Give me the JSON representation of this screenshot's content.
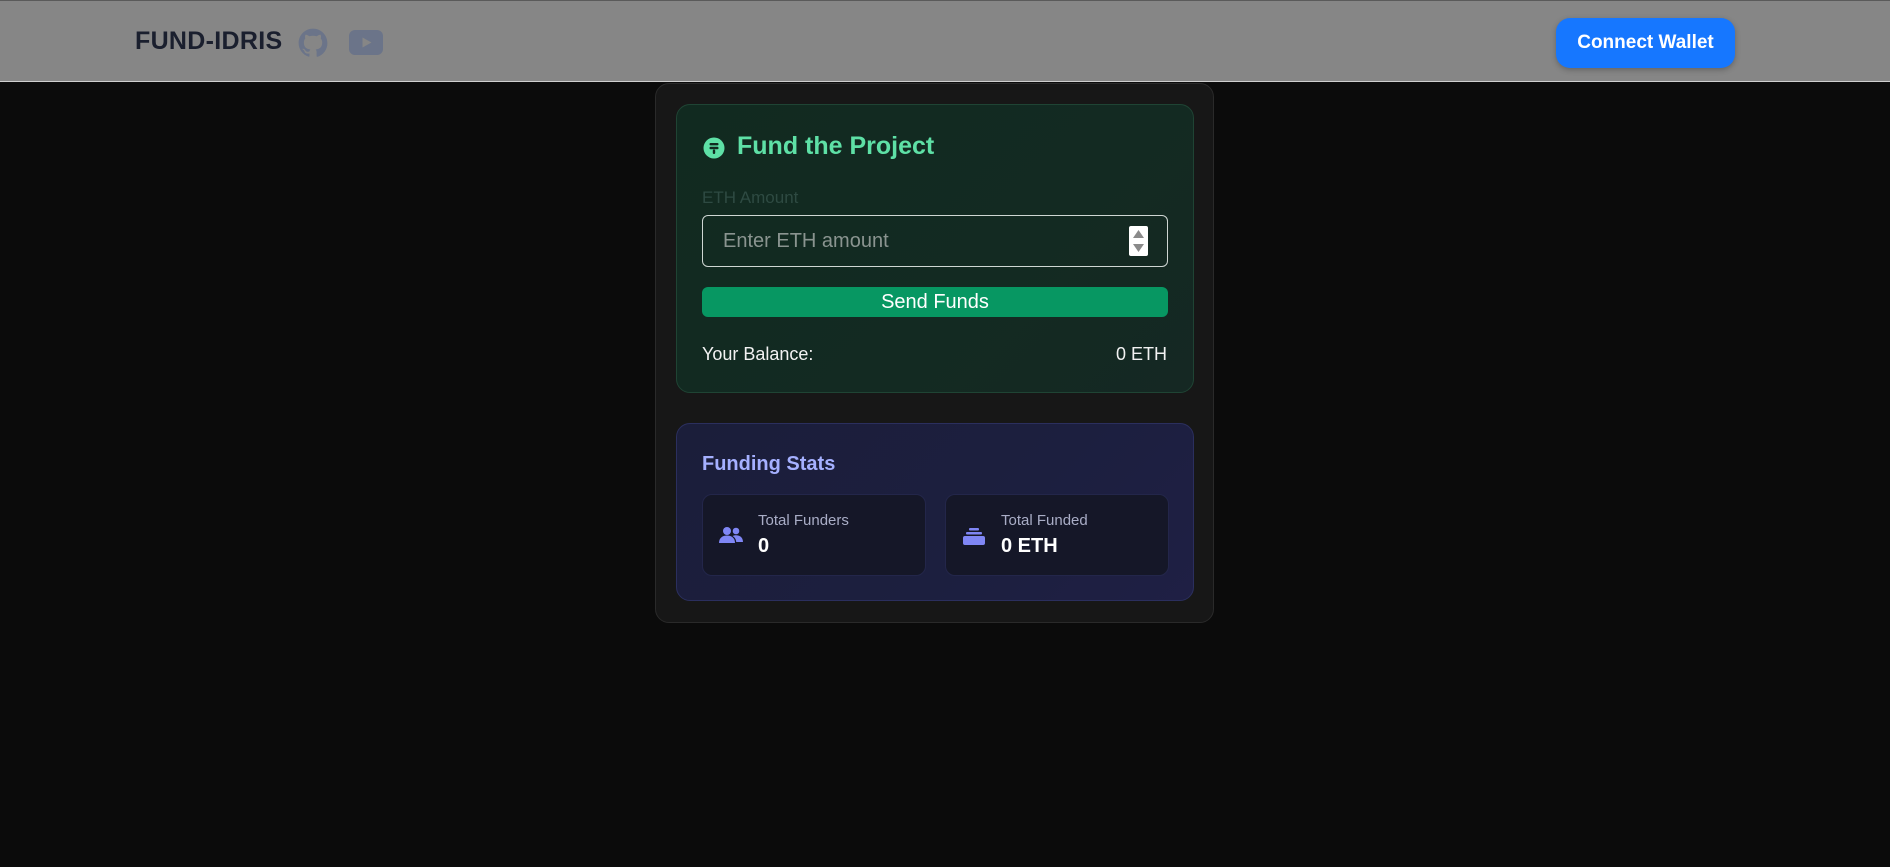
{
  "header": {
    "brand": "FUND-IDRIS",
    "icons": [
      "github-icon",
      "youtube-icon"
    ],
    "connect_label": "Connect Wallet"
  },
  "fund": {
    "title": "Fund the Project",
    "title_icon": "coin-icon",
    "input_label": "ETH Amount",
    "input_value": "",
    "input_placeholder": "Enter ETH amount",
    "send_label": "Send Funds",
    "balance_label": "Your Balance:",
    "balance_value": "0 ETH"
  },
  "stats": {
    "title": "Funding Stats",
    "funders_label": "Total Funders",
    "funders_value": "0",
    "funders_icon": "users-icon",
    "funded_label": "Total Funded",
    "funded_value": "0 ETH",
    "funded_icon": "coins-stack-icon"
  },
  "colors": {
    "topbar": "#868686",
    "connect_button": "#1677ff",
    "send_button": "#079762",
    "fund_title": "#5ee0a6",
    "stats_title": "#a5b0ff",
    "stats_icon": "#7f86f5"
  }
}
